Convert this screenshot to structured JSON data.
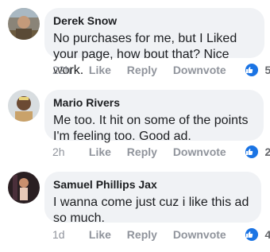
{
  "comments": [
    {
      "author": "Derek Snow",
      "text": "No purchases for me, but I Liked your page, how bout that? Nice work.",
      "time": "22h",
      "like": "Like",
      "reply": "Reply",
      "downvote": "Downvote",
      "reactions": "5"
    },
    {
      "author": "Mario Rivers",
      "text": "Me too. It hit on some of the points I'm feeling too. Good ad.",
      "time": "2h",
      "like": "Like",
      "reply": "Reply",
      "downvote": "Downvote",
      "reactions": "2"
    },
    {
      "author": "Samuel Phillips Jax",
      "text": "I wanna come just cuz i like this ad so much.",
      "time": "1d",
      "like": "Like",
      "reply": "Reply",
      "downvote": "Downvote",
      "reactions": "4"
    }
  ],
  "colors": {
    "bubble": "#f0f2f5",
    "like_badge": "#1b74e4",
    "action_text": "#90949c"
  }
}
